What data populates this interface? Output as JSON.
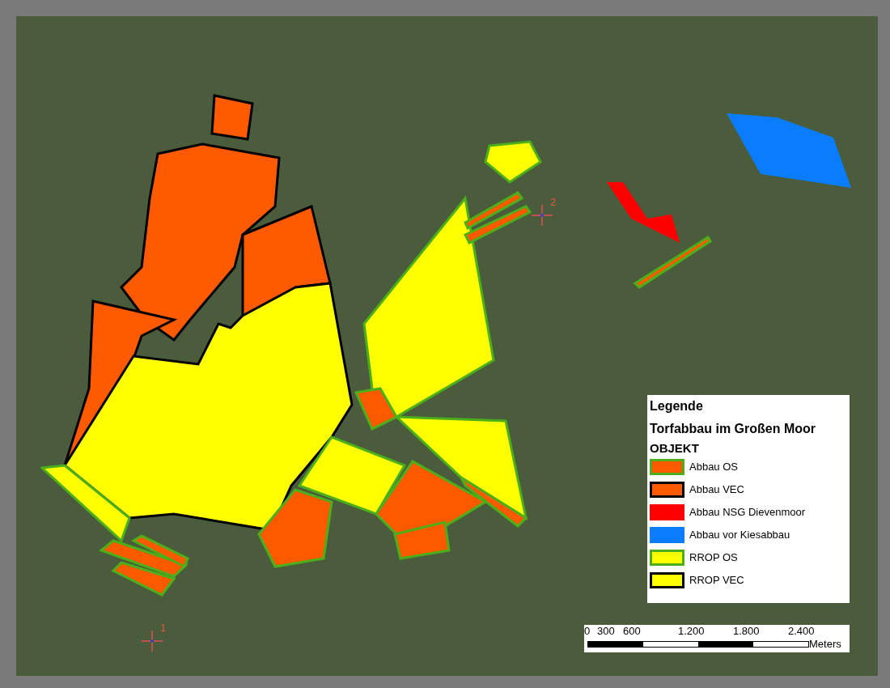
{
  "map": {
    "markers": [
      {
        "label": "1"
      },
      {
        "label": "2"
      }
    ]
  },
  "legend": {
    "title": "Legende",
    "layer": "Torfabbau im Großen Moor",
    "field": "OBJEKT",
    "items": [
      {
        "label": "Abbau OS",
        "color": "#ff5a00",
        "kind": "os"
      },
      {
        "label": "Abbau VEC",
        "color": "#ff5a00",
        "kind": "vec"
      },
      {
        "label": "Abbau NSG Dievenmoor",
        "color": "#ff0000",
        "kind": "plain"
      },
      {
        "label": "Abbau vor Kiesabbau",
        "color": "#0a7dff",
        "kind": "plain"
      },
      {
        "label": "RROP OS",
        "color": "#ffff00",
        "kind": "os"
      },
      {
        "label": "RROP VEC",
        "color": "#ffff00",
        "kind": "vec"
      }
    ]
  },
  "scale_bar": {
    "labels": [
      "0",
      "300",
      "600",
      "1.200",
      "1.800",
      "2.400"
    ],
    "unit": "Meters"
  }
}
